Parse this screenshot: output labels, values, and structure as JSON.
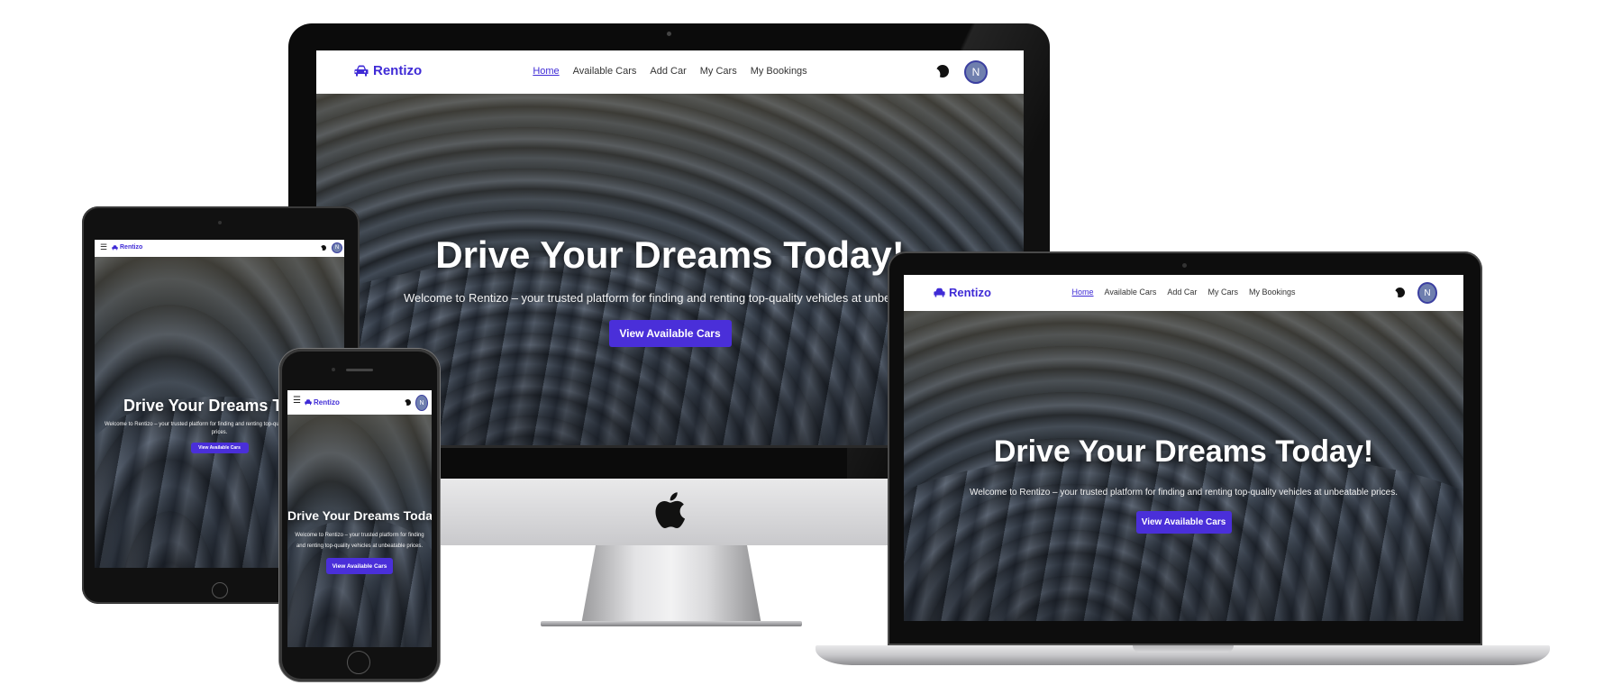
{
  "site": {
    "brand": "Rentizo",
    "nav": {
      "home": "Home",
      "available_cars": "Available Cars",
      "add_car": "Add Car",
      "my_cars": "My Cars",
      "my_bookings": "My Bookings"
    },
    "avatar_initial": "N",
    "hero": {
      "title": "Drive Your Dreams Today!",
      "subtitle": "Welcome to Rentizo – your trusted platform for finding and renting top-quality vehicles at unbeatable prices.",
      "subtitle_desktop_visible": "Welcome to Rentizo – your trusted platform for finding and renting top-quality vehicles at unbeata",
      "subtitle_tablet_visible": "Welcome to Rentizo – your trusted platform for finding and renting top-qua",
      "subtitle_tablet_line2": "prices.",
      "title_tablet_visible": "Drive Your Dreams To",
      "subtitle_phone_line1": "Welcome to Rentizo – your trusted platform for finding",
      "subtitle_phone_line2": "and renting top-quality vehicles at unbeatable prices.",
      "cta": "View Available Cars"
    }
  },
  "colors": {
    "brand": "#3f2bd6",
    "cta": "#4a2fd9",
    "avatar": "#6f7fae"
  },
  "icons": [
    "car-icon",
    "moon-icon",
    "menu-icon",
    "apple-logo-icon"
  ]
}
